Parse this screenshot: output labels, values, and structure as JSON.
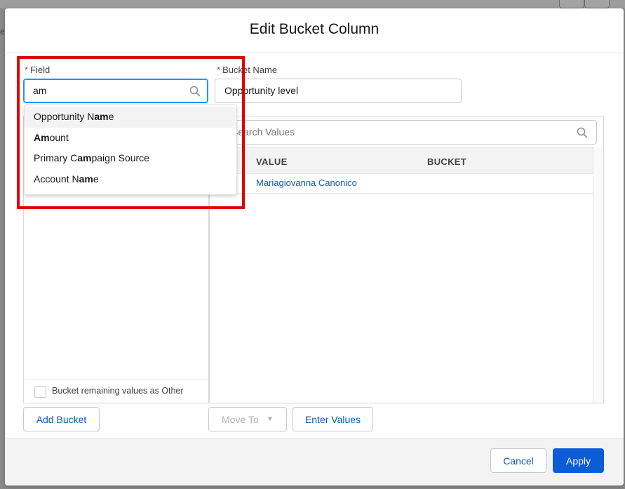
{
  "modal": {
    "title": "Edit Bucket Column"
  },
  "field": {
    "label": "Field",
    "value": "am",
    "suggestions": [
      {
        "pre": "Opportunity N",
        "match": "am",
        "post": "e"
      },
      {
        "pre": "",
        "match": "Am",
        "post": "ount"
      },
      {
        "pre": "Primary C",
        "match": "am",
        "post": "paign Source"
      },
      {
        "pre": "Account N",
        "match": "am",
        "post": "e"
      }
    ]
  },
  "bucket_name": {
    "label": "Bucket Name",
    "value": "Opportunity level"
  },
  "search": {
    "placeholder": "Search Values"
  },
  "table": {
    "headers": [
      "VALUE",
      "BUCKET"
    ],
    "rows": [
      {
        "value": "Mariagiovanna Canonico",
        "bucket": ""
      }
    ]
  },
  "bucket_remaining": {
    "label": "Bucket remaining values as Other"
  },
  "actions": {
    "add_bucket": "Add Bucket",
    "move_to": "Move To",
    "enter_values": "Enter Values"
  },
  "footer": {
    "cancel": "Cancel",
    "apply": "Apply"
  },
  "colors": {
    "accent": "#0b5cd5",
    "highlight_border": "#e00000",
    "required": "#c23934"
  }
}
